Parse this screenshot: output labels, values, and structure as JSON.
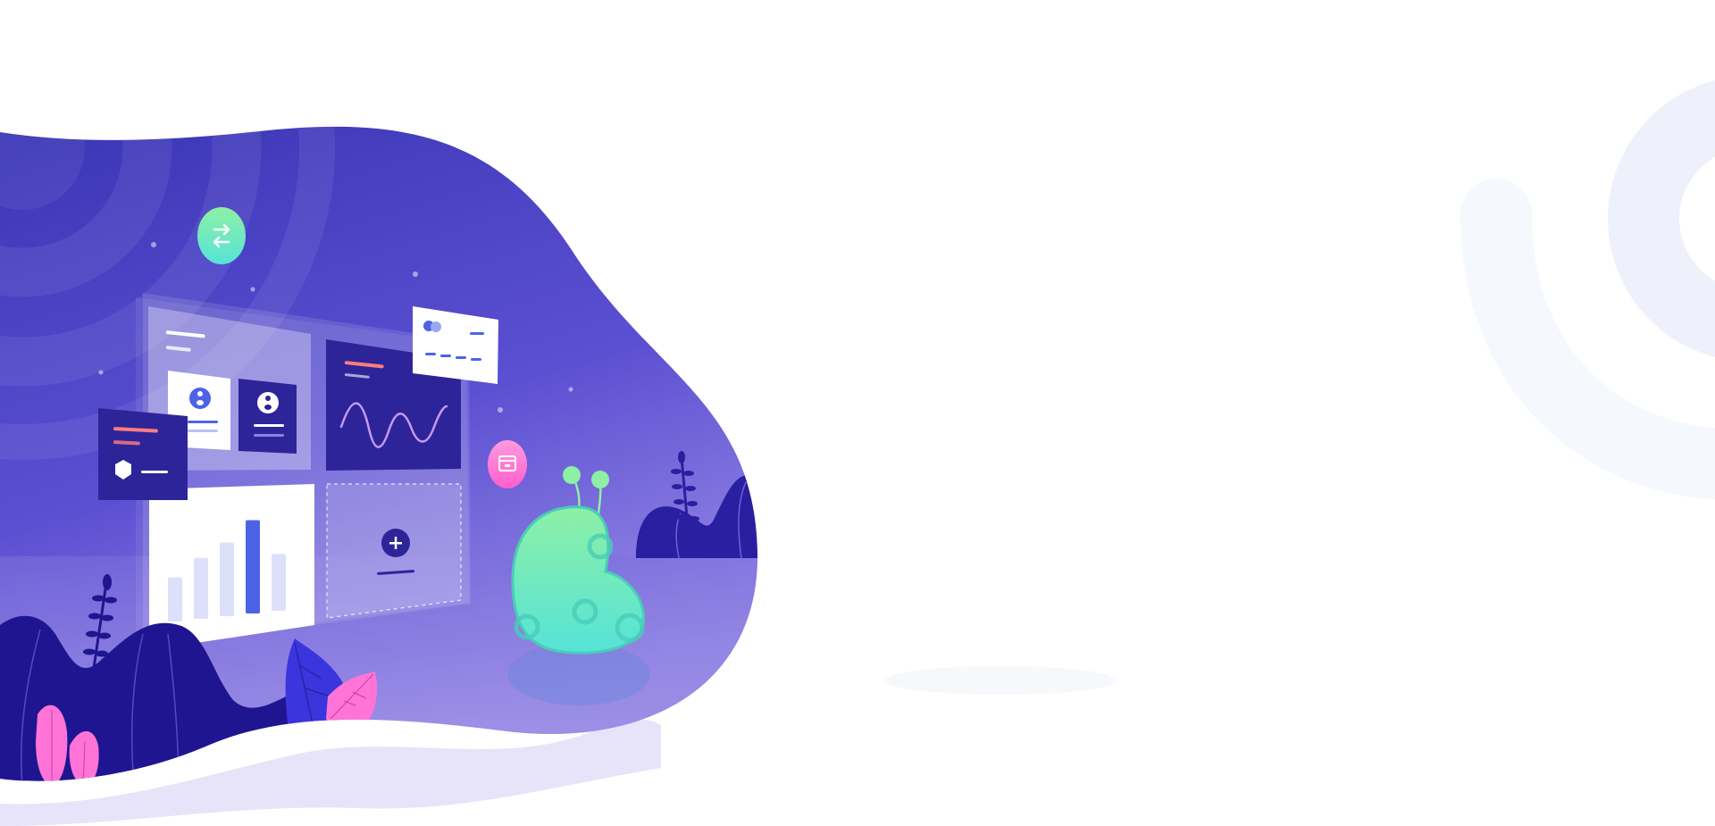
{
  "page": {
    "title": "",
    "background": "#ffffff"
  },
  "colors": {
    "blob_top": "#3b35b8",
    "blob_bottom": "#8f7ee6",
    "blob_deep": "#2a21a6",
    "navy": "#1f1590",
    "dark_card": "#2d2499",
    "light_panel": "#ffffff",
    "accent_pink": "#ff74d6",
    "accent_mint": "#59e7cf",
    "accent_coral": "#ff7d7d",
    "accent_blue": "#4d63e6",
    "soft_lavender": "#e6e3fa",
    "ring_decor": "#eef1fb"
  },
  "icons": [
    "swap-arrows-icon",
    "plus-icon",
    "user-avatar-icon",
    "hexagon-icon",
    "browser-window-icon",
    "credit-card-icon",
    "wave-chart-icon",
    "bar-chart-icon"
  ],
  "illustration": {
    "bar_chart": {
      "values": [
        0.45,
        0.62,
        0.75,
        0.95,
        0.58
      ]
    }
  }
}
